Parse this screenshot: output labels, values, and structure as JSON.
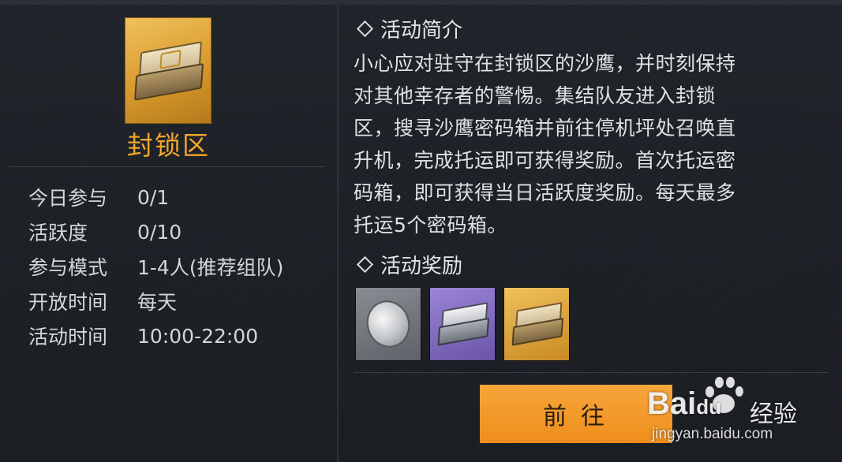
{
  "activity": {
    "name": "封锁区",
    "icon": "gold-crate-icon"
  },
  "stats": [
    {
      "label": "今日参与",
      "value": "0/1"
    },
    {
      "label": "活跃度",
      "value": "0/10"
    },
    {
      "label": "参与模式",
      "value": "1-4人(推荐组队)"
    },
    {
      "label": "开放时间",
      "value": "每天"
    },
    {
      "label": "活动时间",
      "value": "10:00-22:00"
    }
  ],
  "intro": {
    "title": "活动简介",
    "lines": [
      "小心应对驻守在封锁区的沙鹰，并时刻保持",
      "对其他幸存者的警惕。集结队友进入封锁",
      "区，搜寻沙鹰密码箱并前往停机坪处召唤直",
      "升机，完成托运即可获得奖励。首次托运密",
      "码箱，即可获得当日活跃度奖励。每天最多",
      "托运5个密码箱。"
    ]
  },
  "rewards": {
    "title": "活动奖励",
    "items": [
      {
        "icon": "silver-coin-icon",
        "rarity_color": "#7a7d83"
      },
      {
        "icon": "silver-crate-icon",
        "rarity_color": "#7e68bd"
      },
      {
        "icon": "gold-crate-icon",
        "rarity_color": "#e0a53c"
      }
    ]
  },
  "go_button": {
    "label": "前往"
  },
  "watermark": {
    "brand": "Bai",
    "brand_suffix": "du",
    "jingyan": "经验",
    "url": "jingyan.baidu.com"
  },
  "colors": {
    "accent": "#f2a62c",
    "button": "#f09a2a",
    "background": "#1b1e23"
  }
}
